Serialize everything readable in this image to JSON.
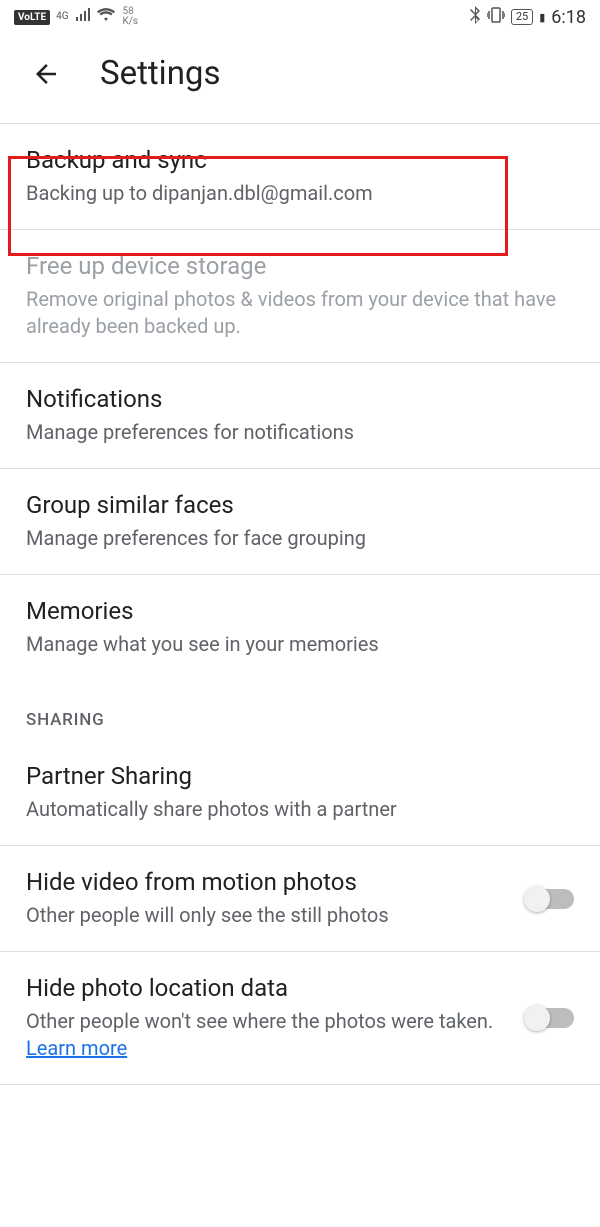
{
  "status": {
    "volte": "VoLTE",
    "net_type": "4G",
    "speed_num": "58",
    "speed_unit": "K/s",
    "battery": "25",
    "time": "6:18"
  },
  "header": {
    "title": "Settings"
  },
  "settings": {
    "backup": {
      "title": "Backup and sync",
      "sub": "Backing up to dipanjan.dbl@gmail.com"
    },
    "free_up": {
      "title": "Free up device storage",
      "sub": "Remove original photos & videos from your device that have already been backed up."
    },
    "notifications": {
      "title": "Notifications",
      "sub": "Manage preferences for notifications"
    },
    "faces": {
      "title": "Group similar faces",
      "sub": "Manage preferences for face grouping"
    },
    "memories": {
      "title": "Memories",
      "sub": "Manage what you see in your memories"
    }
  },
  "sharing": {
    "header": "SHARING",
    "partner": {
      "title": "Partner Sharing",
      "sub": "Automatically share photos with a partner"
    },
    "hide_video": {
      "title": "Hide video from motion photos",
      "sub": "Other people will only see the still photos"
    },
    "hide_location": {
      "title": "Hide photo location data",
      "sub_prefix": "Other people won't see where the photos were taken. ",
      "learn_more": "Learn more"
    }
  }
}
